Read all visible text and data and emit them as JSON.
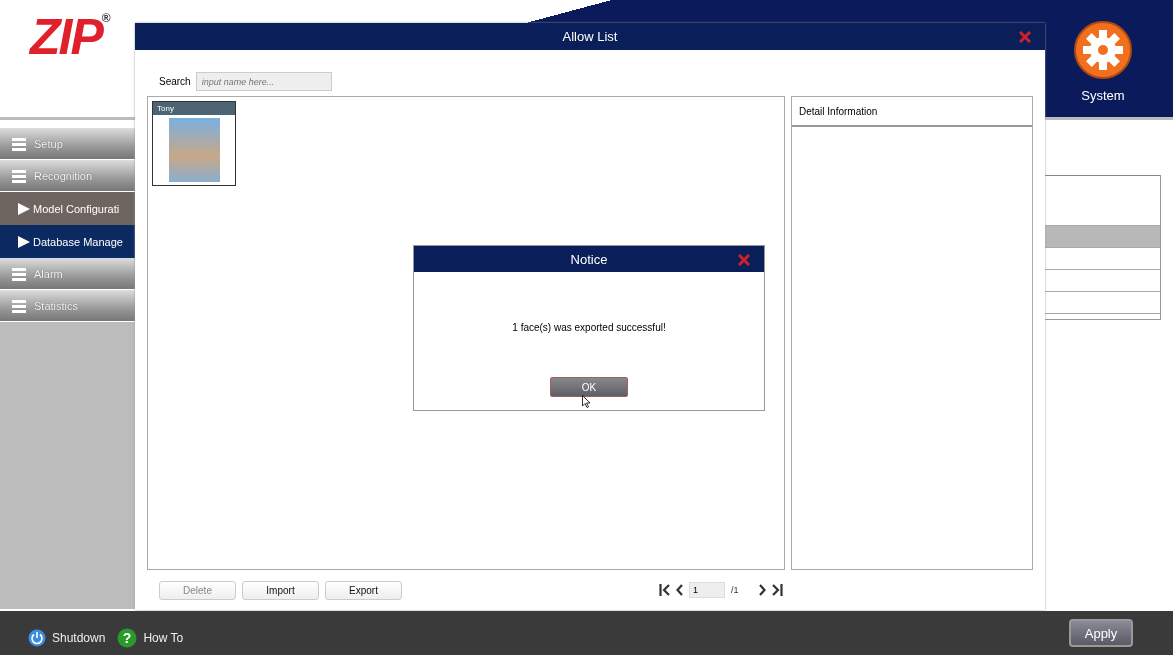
{
  "app": {
    "logo": "ZIP",
    "logo_mark": "®",
    "system_label": "System",
    "sidebar": [
      {
        "kind": "group",
        "label": "Setup",
        "selected": false
      },
      {
        "kind": "group",
        "label": "Recognition",
        "selected": false
      },
      {
        "kind": "sub",
        "label": "Model Configurati",
        "selected": false
      },
      {
        "kind": "sub",
        "label": "Database Manage",
        "selected": true
      },
      {
        "kind": "group",
        "label": "Alarm",
        "selected": false
      },
      {
        "kind": "group",
        "label": "Statistics",
        "selected": false
      }
    ],
    "table_rows": [
      {
        "selected": false
      },
      {
        "selected": true
      },
      {
        "selected": false
      },
      {
        "selected": false
      },
      {
        "selected": false
      }
    ],
    "footer": {
      "shutdown": "Shutdown",
      "help_glyph": "?",
      "howto": "How To",
      "apply": "Apply"
    }
  },
  "dialog": {
    "title": "Allow List",
    "search_label": "Search",
    "search_placeholder": "input name here...",
    "faces": [
      {
        "name": "Tony",
        "selected": false
      }
    ],
    "detail_title": "Detail Information",
    "buttons": [
      {
        "label": "Delete",
        "disabled": true
      },
      {
        "label": "Import",
        "disabled": false
      },
      {
        "label": "Export",
        "disabled": false
      }
    ],
    "pager": {
      "page": "1",
      "total": "/1"
    }
  },
  "notice": {
    "title": "Notice",
    "message": "1 face(s) was exported successful!",
    "ok": "OK"
  }
}
